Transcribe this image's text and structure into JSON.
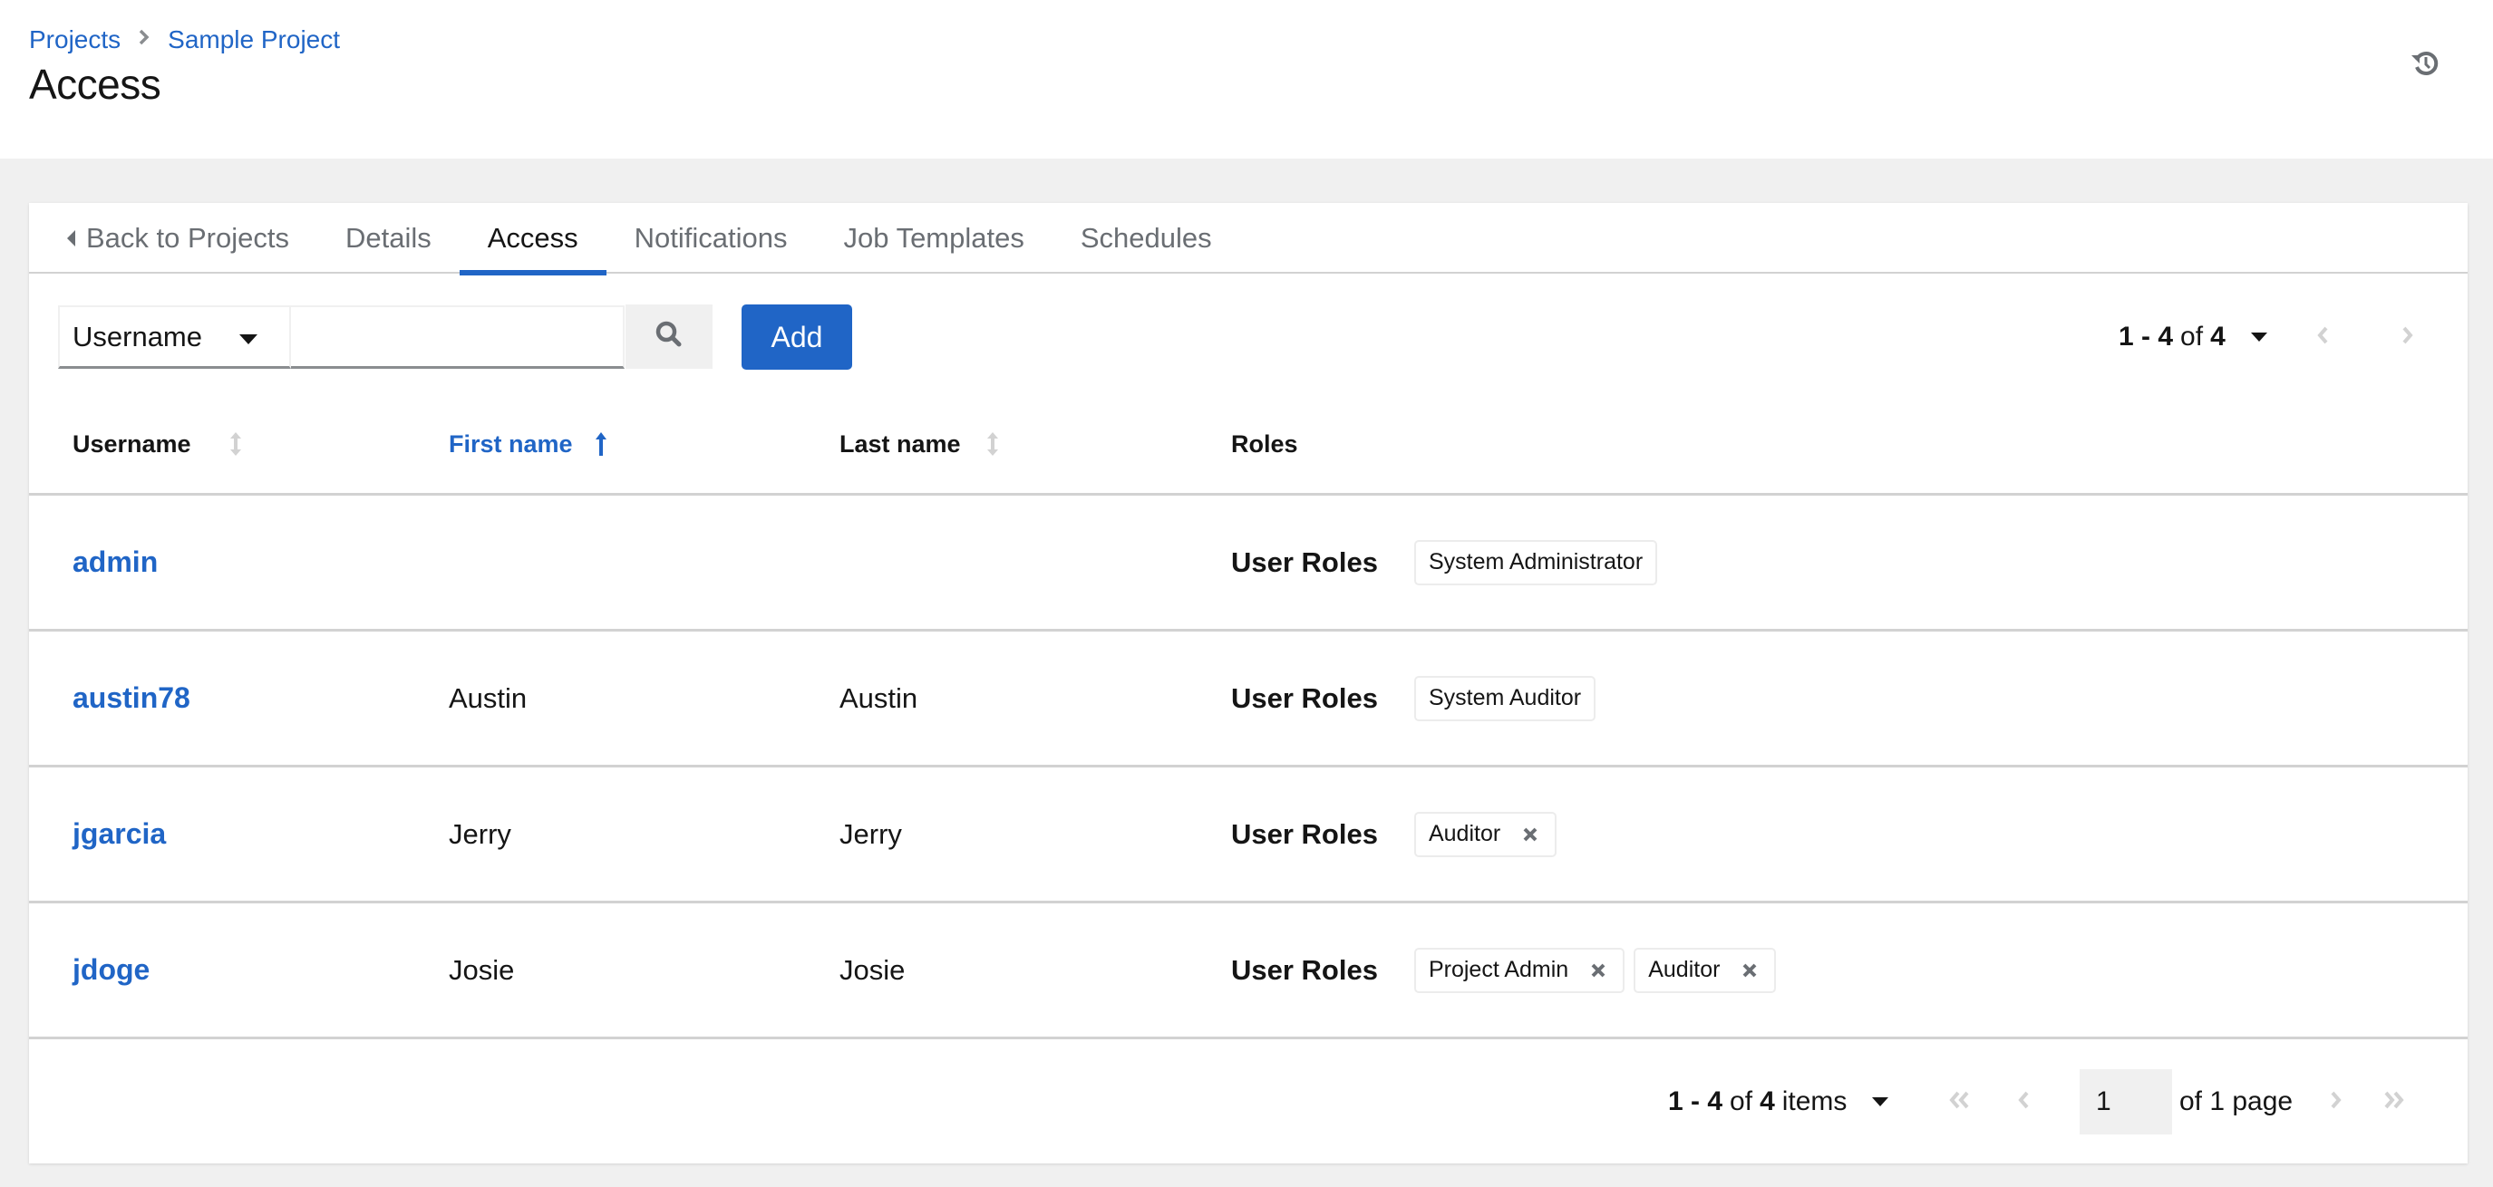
{
  "breadcrumb": {
    "items": [
      "Projects",
      "Sample Project"
    ]
  },
  "header": {
    "title": "Access",
    "history_icon": "history-icon"
  },
  "tabs": [
    {
      "label": "Back to Projects",
      "icon": "caret-left-icon",
      "active": false
    },
    {
      "label": "Details",
      "active": false
    },
    {
      "label": "Access",
      "active": true
    },
    {
      "label": "Notifications",
      "active": false
    },
    {
      "label": "Job Templates",
      "active": false
    },
    {
      "label": "Schedules",
      "active": false
    }
  ],
  "toolbar": {
    "filter_select": "Username",
    "search_value": "",
    "search_placeholder": "",
    "add_label": "Add",
    "pager": {
      "range": "1 - 4",
      "of": "of",
      "total": "4"
    }
  },
  "table": {
    "columns": [
      {
        "label": "Username",
        "sort": "none"
      },
      {
        "label": "First name",
        "sort": "ascending"
      },
      {
        "label": "Last name",
        "sort": "none"
      },
      {
        "label": "Roles",
        "sort": null
      }
    ],
    "rows": [
      {
        "username": "admin",
        "first_name": "",
        "last_name": "",
        "roles_label": "User Roles",
        "roles": [
          {
            "name": "System Administrator",
            "removable": false
          }
        ]
      },
      {
        "username": "austin78",
        "first_name": "Austin",
        "last_name": "Austin",
        "roles_label": "User Roles",
        "roles": [
          {
            "name": "System Auditor",
            "removable": false
          }
        ]
      },
      {
        "username": "jgarcia",
        "first_name": "Jerry",
        "last_name": "Jerry",
        "roles_label": "User Roles",
        "roles": [
          {
            "name": "Auditor",
            "removable": true
          }
        ]
      },
      {
        "username": "jdoge",
        "first_name": "Josie",
        "last_name": "Josie",
        "roles_label": "User Roles",
        "roles": [
          {
            "name": "Project Admin",
            "removable": true
          },
          {
            "name": "Auditor",
            "removable": true
          }
        ]
      }
    ]
  },
  "pagination": {
    "range": "1 - 4",
    "of": "of",
    "total": "4",
    "items_label": "items",
    "current_page": "1",
    "of_pages": "of 1 page"
  },
  "colors": {
    "accent": "#2065c6",
    "background": "#f0f0f0",
    "border": "#d2d2d2",
    "disabled_icon": "#d2d2d2"
  }
}
